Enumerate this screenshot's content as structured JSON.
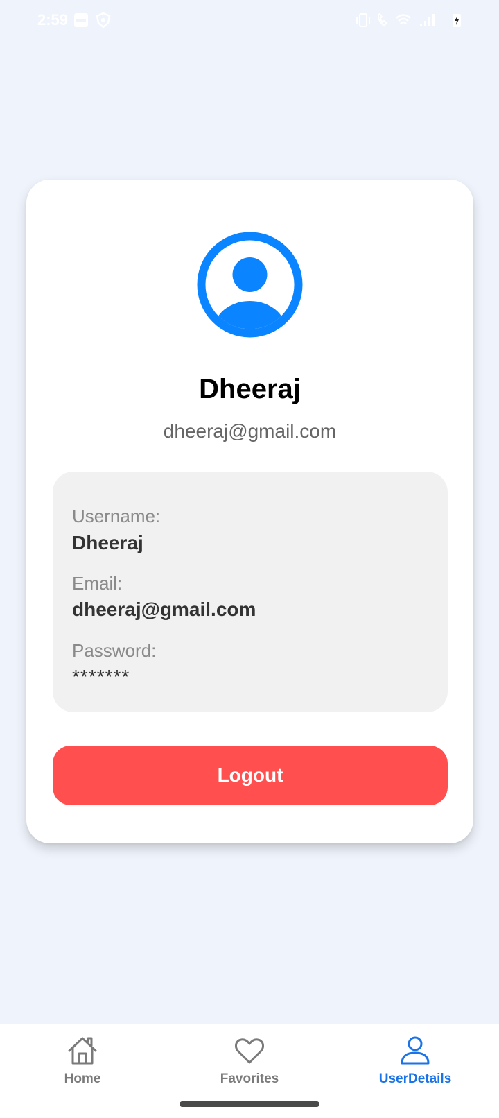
{
  "status_bar": {
    "time": "2:59",
    "left_icons": [
      "gallery-icon",
      "shield-icon"
    ],
    "right_icons": [
      "vibrate-icon",
      "wifi-call-icon",
      "wifi-icon",
      "signal-icon",
      "battery-charging-icon"
    ]
  },
  "profile": {
    "avatar_icon": "account-circle-icon",
    "name": "Dheeraj",
    "email": "dheeraj@gmail.com",
    "accent_color": "#0a84ff"
  },
  "details": {
    "username_label": "Username:",
    "username_value": "Dheeraj",
    "email_label": "Email:",
    "email_value": "dheeraj@gmail.com",
    "password_label": "Password:",
    "password_value": "*******"
  },
  "logout": {
    "label": "Logout",
    "color": "#ff4f4f"
  },
  "nav": {
    "items": [
      {
        "label": "Home",
        "icon": "home-icon",
        "active": false
      },
      {
        "label": "Favorites",
        "icon": "heart-icon",
        "active": false
      },
      {
        "label": "UserDetails",
        "icon": "user-icon",
        "active": true
      }
    ],
    "active_color": "#1a73e8",
    "inactive_color": "#7a7a7a"
  }
}
